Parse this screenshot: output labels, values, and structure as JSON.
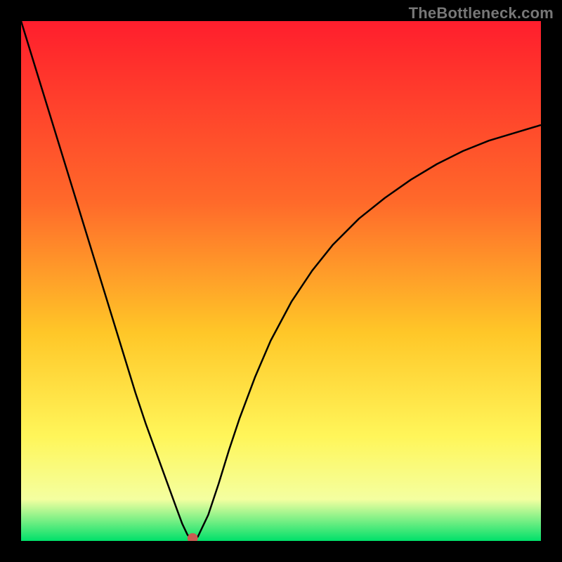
{
  "watermark": "TheBottleneck.com",
  "colors": {
    "frame": "#000000",
    "gradient_top": "#ff1e2d",
    "gradient_mid1": "#ff6a2a",
    "gradient_mid2": "#ffc728",
    "gradient_mid3": "#fff65a",
    "gradient_mid4": "#f4ffa0",
    "gradient_bottom": "#00e06a",
    "curve": "#000000",
    "marker": "#c95b52"
  },
  "chart_data": {
    "type": "line",
    "title": "",
    "xlabel": "",
    "ylabel": "",
    "xlim": [
      0,
      100
    ],
    "ylim": [
      0,
      100
    ],
    "series": [
      {
        "name": "bottleneck-curve",
        "x": [
          0,
          2,
          4,
          6,
          8,
          10,
          12,
          14,
          16,
          18,
          20,
          22,
          24,
          26,
          28,
          30,
          31,
          32,
          33,
          34,
          36,
          38,
          40,
          42,
          45,
          48,
          52,
          56,
          60,
          65,
          70,
          75,
          80,
          85,
          90,
          95,
          100
        ],
        "y": [
          100,
          93.5,
          87,
          80.5,
          74,
          67.5,
          61,
          54.5,
          48,
          41.5,
          35,
          28.5,
          22.5,
          17,
          11.5,
          6,
          3.3,
          1.2,
          0.0,
          0.8,
          5,
          11,
          17.5,
          23.5,
          31.5,
          38.5,
          46,
          52,
          57,
          62,
          66,
          69.5,
          72.5,
          75,
          77,
          78.5,
          80
        ]
      }
    ],
    "marker": {
      "x": 33,
      "y": 0.5,
      "r": 1.0
    },
    "annotations": []
  }
}
